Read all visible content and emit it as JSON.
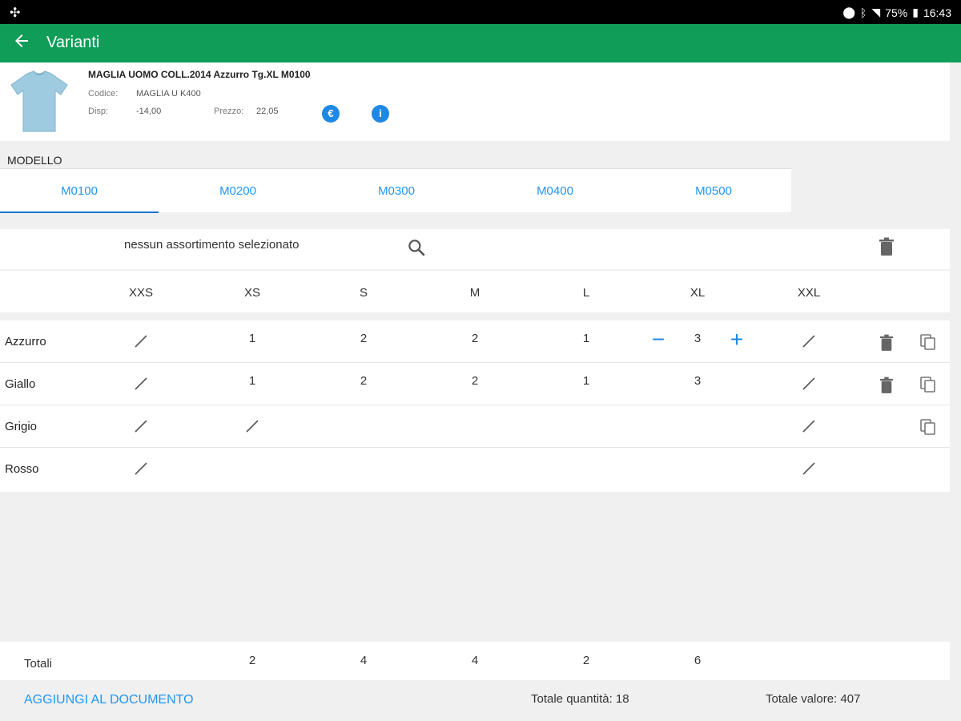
{
  "status_bar": {
    "time": "16:43",
    "battery": "75%",
    "icons": [
      "app-icon",
      "location-icon",
      "bluetooth-icon",
      "wifi-icon",
      "signal-icon",
      "battery-icon"
    ]
  },
  "app_bar": {
    "title": "Varianti",
    "back_icon": "arrow-left-icon"
  },
  "product": {
    "name": "MAGLIA UOMO COLL.2014 Azzurro Tg.XL M0100",
    "codice_label": "Codice:",
    "codice_value": "MAGLIA U K400",
    "disp_label": "Disp:",
    "disp_value": "-14,00",
    "prezzo_label": "Prezzo:",
    "prezzo_value": "22,05",
    "euro_icon": "€",
    "info_icon": "i"
  },
  "modello_label": "MODELLO",
  "tabs": [
    {
      "label": "M0100",
      "active": true
    },
    {
      "label": "M0200",
      "active": false
    },
    {
      "label": "M0300",
      "active": false
    },
    {
      "label": "M0400",
      "active": false
    },
    {
      "label": "M0500",
      "active": false
    }
  ],
  "assortment": {
    "text": "nessun assortimento selezionato"
  },
  "sizes": [
    "XXS",
    "XS",
    "S",
    "M",
    "L",
    "XL",
    "XXL"
  ],
  "rows": [
    {
      "color": "Azzurro",
      "cells": [
        "edit",
        "1",
        "2",
        "2",
        "1",
        "3",
        "edit"
      ],
      "has_stepper": true,
      "has_trash": true,
      "has_copy": true
    },
    {
      "color": "Giallo",
      "cells": [
        "edit",
        "1",
        "2",
        "2",
        "1",
        "3",
        "edit"
      ],
      "has_stepper": false,
      "has_trash": true,
      "has_copy": true
    },
    {
      "color": "Grigio",
      "cells": [
        "edit",
        "edit",
        "",
        "",
        "",
        "",
        "edit"
      ],
      "has_stepper": false,
      "has_trash": false,
      "has_copy": true
    },
    {
      "color": "Rosso",
      "cells": [
        "edit",
        "",
        "",
        "",
        "",
        "",
        "edit"
      ],
      "has_stepper": false,
      "has_trash": false,
      "has_copy": false
    }
  ],
  "stepper": {
    "minus": "−",
    "plus": "+"
  },
  "totals": {
    "label": "Totali",
    "values": [
      "",
      "2",
      "4",
      "4",
      "2",
      "6",
      ""
    ]
  },
  "footer": {
    "add_label": "AGGIUNGI AL DOCUMENTO",
    "total_quantity": "Totale quantità: 18",
    "total_value": "Totale valore: 407"
  },
  "colors": {
    "primary": "#0f9d58",
    "accent": "#2196f3",
    "icon_blue": "#1e88e5"
  }
}
